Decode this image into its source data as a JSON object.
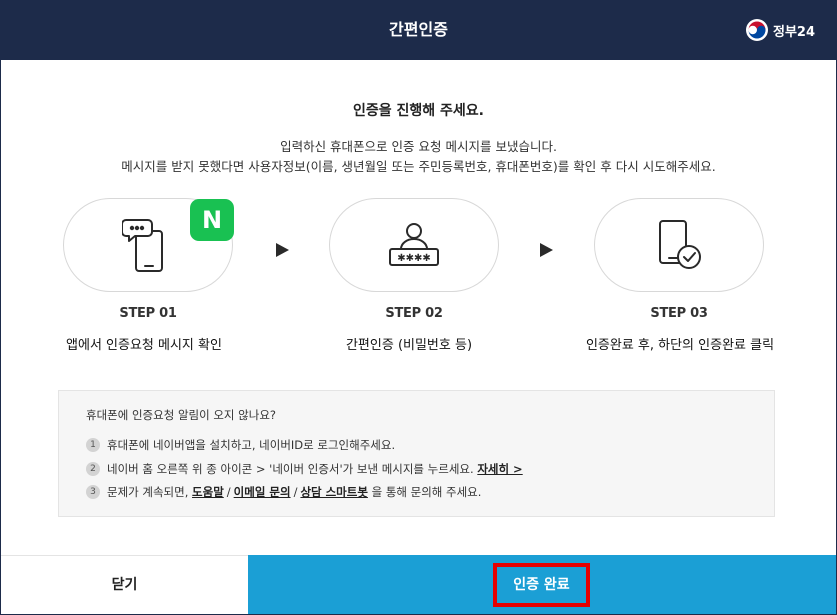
{
  "header": {
    "title": "간편인증",
    "logo_text": "정부24",
    "logo_icon": "korea-taegeuk-icon"
  },
  "main": {
    "heading": "인증을 진행해 주세요.",
    "desc_line1": "입력하신 휴대폰으로 인증 요청 메시지를 보냈습니다.",
    "desc_line2": "메시지를 받지 못했다면 사용자정보(이름, 생년월일 또는 주민등록번호, 휴대폰번호)를 확인 후 다시 시도해주세요."
  },
  "naver_badge": "N",
  "steps": [
    {
      "label": "STEP 01",
      "desc": "앱에서 인증요청 메시지 확인",
      "icon": "phone-chat-icon"
    },
    {
      "label": "STEP 02",
      "desc": "간편인증 (비밀번호 등)",
      "icon": "user-password-icon"
    },
    {
      "label": "STEP 03",
      "desc": "인증완료 후, 하단의 인증완료 클릭",
      "icon": "phone-check-icon"
    }
  ],
  "help": {
    "title": "휴대폰에 인증요청 알림이 오지 않나요?",
    "items": [
      {
        "num": "1",
        "text": "휴대폰에 네이버앱을 설치하고, 네이버ID로 로그인해주세요."
      },
      {
        "num": "2",
        "text": "네이버 홈 오른쪽 위 종 아이콘 > '네이버 인증서'가 보낸 메시지를 누르세요.",
        "link": "자세히 >"
      },
      {
        "num": "3",
        "text_before": "문제가 계속되면,",
        "links": [
          "도움말",
          "이메일 문의",
          "상담 스마트봇"
        ],
        "sep": "/",
        "text_after": "을 통해 문의해 주세요."
      }
    ]
  },
  "footer": {
    "close_label": "닫기",
    "complete_label": "인증 완료"
  },
  "colors": {
    "header_bg": "#1d2b4a",
    "primary_button": "#1b9fd5",
    "naver_green": "#19c152",
    "highlight_red": "#e50000"
  }
}
